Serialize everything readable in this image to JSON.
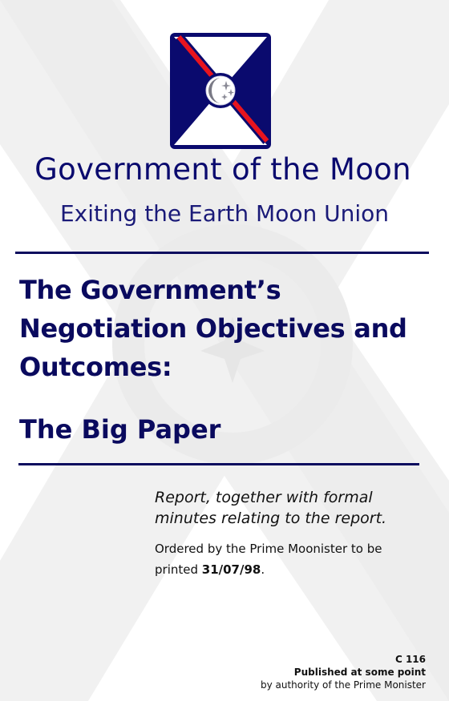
{
  "header": {
    "organization": "Government of the Moon",
    "department": "Exiting the Earth Moon Union"
  },
  "document": {
    "title_lines": [
      "The Government’s",
      "Negotiation Objectives and",
      "Outcomes:"
    ],
    "subtitle": "The Big Paper"
  },
  "notes": {
    "report_lines": [
      "Report, together with formal",
      "minutes relating to the report."
    ],
    "ordered_line1": "Ordered by the Prime Moonister to be",
    "ordered_prefix": "printed ",
    "ordered_date": "31/07/98",
    "ordered_suffix": "."
  },
  "footer": {
    "code": "C 116",
    "published": "Published at some point",
    "authority": "by authority of the Prime Monister"
  },
  "colors": {
    "navy": "#0a0a6e",
    "red": "#e8141e",
    "watermark": "#f0f0f0"
  },
  "icons": {
    "logo": "moon-crest-icon",
    "watermark": "saltire-moon-watermark"
  }
}
